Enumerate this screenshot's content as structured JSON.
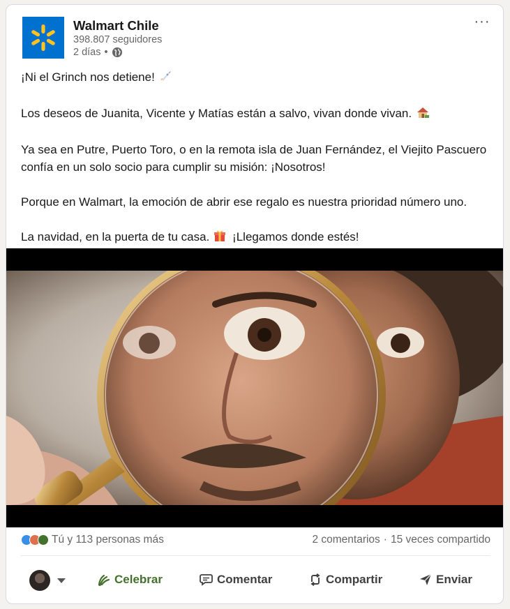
{
  "author": {
    "name": "Walmart Chile",
    "followers": "398.807 seguidores",
    "time": "2 días",
    "visibility_sep": "•",
    "logo_color": "#0071ce",
    "spark_color": "#ffc220"
  },
  "menu": {
    "more_label": "···"
  },
  "post": {
    "line1": "¡Ni el Grinch nos detiene!",
    "line2": "Los deseos de Juanita, Vicente y Matías están a salvo, vivan donde vivan.",
    "line3": "Ya sea en Putre, Puerto Toro, o en la remota isla de Juan Fernández, el Viejito Pascuero confía en un solo socio para cumplir su misión: ¡Nosotros!",
    "line4": "Porque en Walmart, la emoción de abrir ese regalo es nuestra prioridad número uno.",
    "line5a": "La navidad, en la puerta de tu casa.",
    "line5b": "¡Llegamos donde estés!",
    "emoji": [
      "rocket-emoji",
      "house-emoji",
      "gift-emoji"
    ]
  },
  "social": {
    "reactions_text": "Tú y 113 personas más",
    "comments": "2 comentarios",
    "separator": "·",
    "shares": "15 veces compartido",
    "reaction_colors": [
      "#378fe9",
      "#df704d",
      "#44712e"
    ]
  },
  "actions": {
    "celebrate": "Celebrar",
    "comment": "Comentar",
    "share": "Compartir",
    "send": "Enviar",
    "celebrate_color": "#44712e"
  }
}
